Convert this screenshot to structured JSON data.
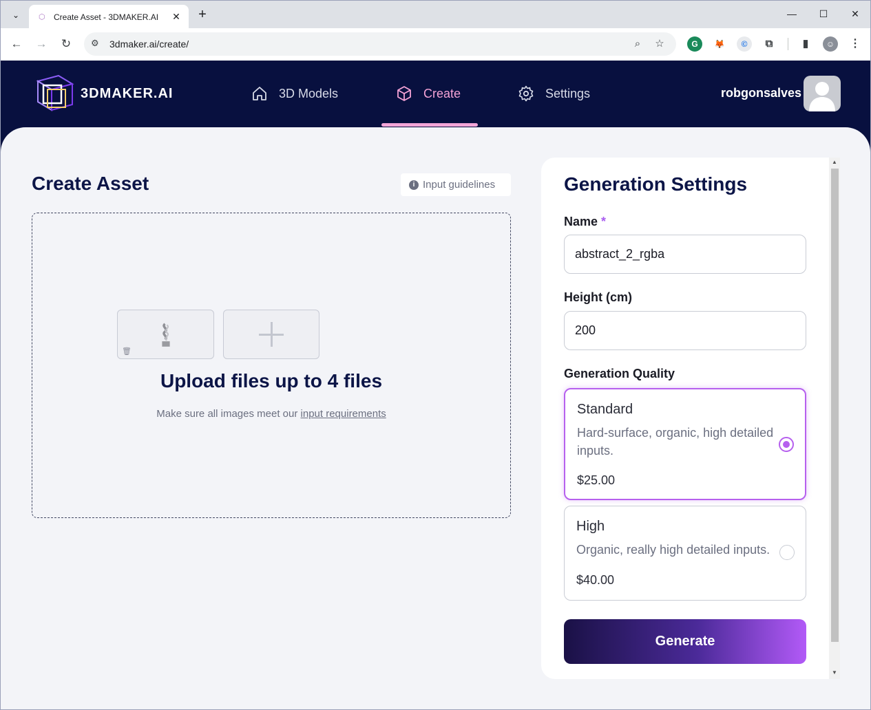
{
  "browser": {
    "tab_title": "Create Asset - 3DMAKER.AI",
    "url": "3dmaker.ai/create/"
  },
  "header": {
    "brand": "3DMAKER.AI",
    "nav": [
      {
        "label": "3D Models",
        "icon": "home-icon"
      },
      {
        "label": "Create",
        "icon": "cube-icon",
        "active": true
      },
      {
        "label": "Settings",
        "icon": "gear-icon"
      }
    ],
    "username": "robgonsalves"
  },
  "create": {
    "title": "Create Asset",
    "guidelines_label": "Input guidelines",
    "upload_title": "Upload files up to 4 files",
    "upload_sub_prefix": "Make sure all images meet our",
    "upload_sub_link": "input requirements"
  },
  "settings": {
    "title": "Generation Settings",
    "name_label": "Name",
    "name_required_mark": "*",
    "name_value": "abstract_2_rgba",
    "height_label": "Height (cm)",
    "height_value": "200",
    "quality_label": "Generation Quality",
    "options": [
      {
        "name": "Standard",
        "desc": "Hard-surface, organic, high detailed inputs.",
        "price": "$25.00",
        "selected": true
      },
      {
        "name": "High",
        "desc": "Organic, really high detailed inputs.",
        "price": "$40.00",
        "selected": false
      }
    ],
    "generate_label": "Generate"
  },
  "colors": {
    "header_bg": "#08103f",
    "accent": "#b660ee",
    "active_nav": "#f5a3d6"
  }
}
